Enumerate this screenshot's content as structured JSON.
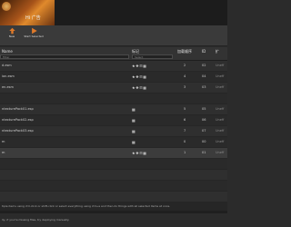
{
  "banner": {
    "title": "Hi 广告"
  },
  "toolbar": {
    "buttons": [
      {
        "label": "New",
        "icon": "arrow-up-icon"
      },
      {
        "label": "Start Selected",
        "icon": "play-icon"
      }
    ]
  },
  "table": {
    "headers": {
      "name": "Name",
      "tags": "标记",
      "n1": "加载顺序",
      "n2": "ID",
      "ext": "扩"
    },
    "filter_name_placeholder": "Filter",
    "filter_tags_placeholder": "Select",
    "rows": [
      {
        "name": "d.esm",
        "tags": "★❖☶▦",
        "n1": "2",
        "n2": "02",
        "ext": "Uneff"
      },
      {
        "name": "ion.esm",
        "tags": "★❖☶▦",
        "n1": "4",
        "n2": "04",
        "ext": "Uneff"
      },
      {
        "name": "en.esm",
        "tags": "★❖☶▦",
        "n1": "3",
        "n2": "03",
        "ext": "Uneff"
      },
      {
        "name": "",
        "tags": "",
        "n1": "",
        "n2": "",
        "ext": ""
      },
      {
        "name": "ntexturePack01.esp",
        "tags": "▦",
        "n1": "5",
        "n2": "05",
        "ext": "Uneff"
      },
      {
        "name": "ntexturePack02.esp",
        "tags": "▦",
        "n1": "6",
        "n2": "06",
        "ext": "Uneff"
      },
      {
        "name": "ntexturePack03.esp",
        "tags": "▦",
        "n1": "7",
        "n2": "07",
        "ext": "Uneff"
      },
      {
        "name": "m",
        "tags": "▦",
        "n1": "0",
        "n2": "00",
        "ext": "Uneff"
      },
      {
        "name": "m",
        "tags": "★❖☶▦",
        "n1": "1",
        "n2": "01",
        "ext": "Uneff"
      },
      {
        "name": "",
        "tags": "",
        "n1": "",
        "n2": "",
        "ext": ""
      },
      {
        "name": "",
        "tags": "",
        "n1": "",
        "n2": "",
        "ext": ""
      },
      {
        "name": "",
        "tags": "",
        "n1": "",
        "n2": "",
        "ext": ""
      },
      {
        "name": "",
        "tags": "",
        "n1": "",
        "n2": "",
        "ext": ""
      },
      {
        "name": "",
        "tags": "",
        "n1": "",
        "n2": "",
        "ext": ""
      }
    ]
  },
  "status_text": "tiple items using ctrl-click or shift-click or select everything using ctrl+a and then do things with all selected items at once.",
  "footer_text": "lly, if you're missing files, try deploying manually."
}
